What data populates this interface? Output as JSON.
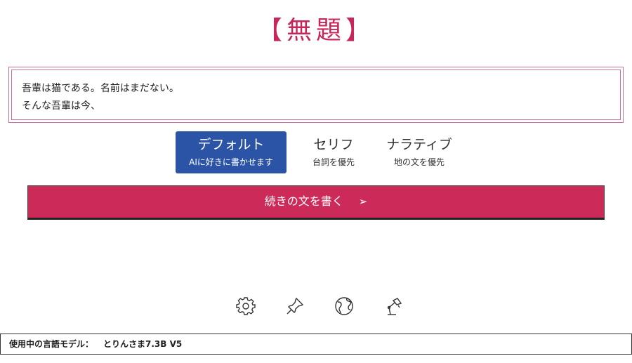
{
  "header": {
    "title": "【無題】"
  },
  "editor": {
    "lines": [
      "吾輩は猫である。名前はまだない。",
      "そんな吾輩は今、"
    ]
  },
  "modes": [
    {
      "label": "デフォルト",
      "sub": "AIに好きに書かせます",
      "active": true
    },
    {
      "label": "セリフ",
      "sub": "台詞を優先",
      "active": false
    },
    {
      "label": "ナラティブ",
      "sub": "地の文を優先",
      "active": false
    }
  ],
  "write_button": {
    "label": "続きの文を書く",
    "arrow": "➢"
  },
  "toolbar_icons": [
    "gear-icon",
    "pin-icon",
    "globe-icon",
    "desk-lamp-icon"
  ],
  "footer": {
    "model_label": "使用中の言語モデル：",
    "model_name": "とりんさま7.3B V5"
  },
  "colors": {
    "accent": "#cc2a59",
    "mode_active": "#2b54a7",
    "title": "#c8265a"
  }
}
